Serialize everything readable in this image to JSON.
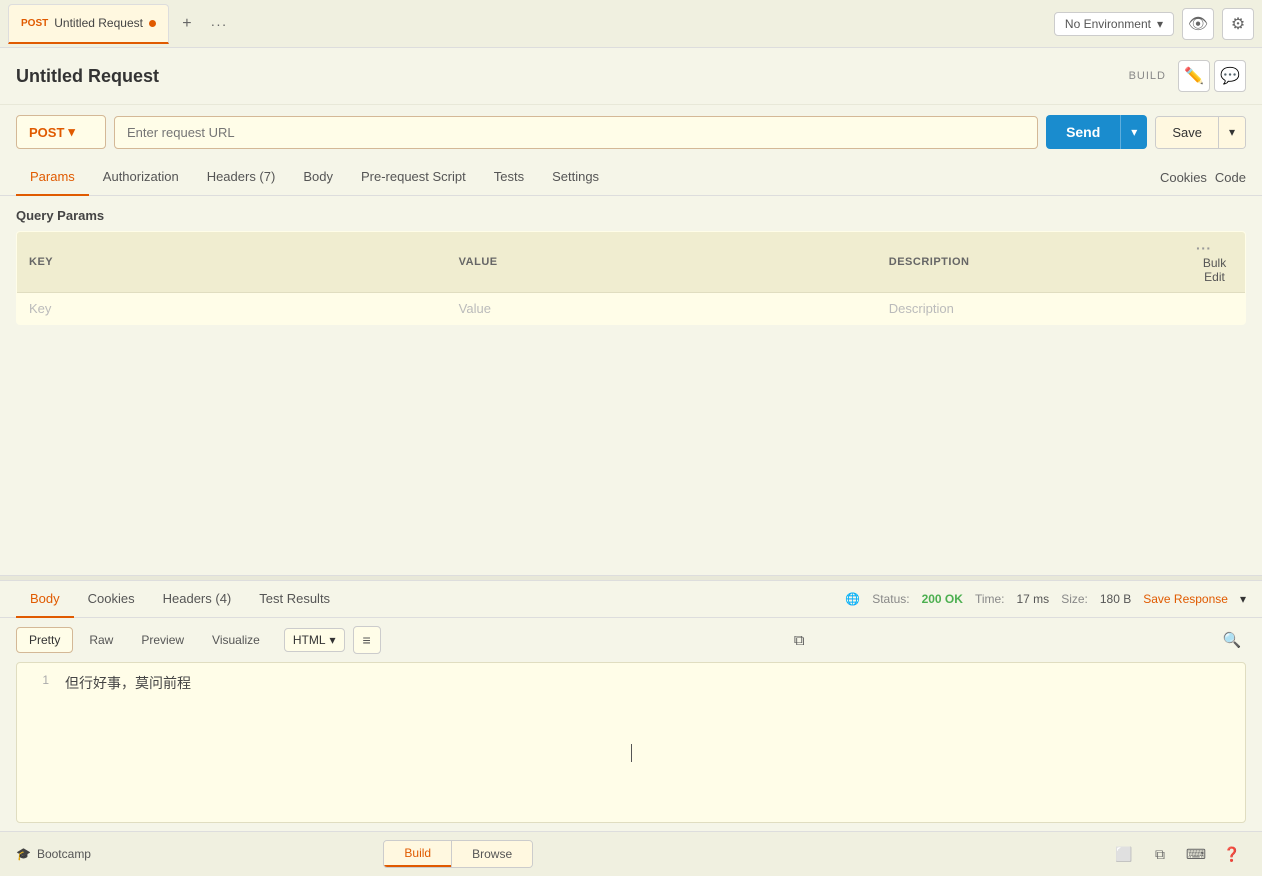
{
  "tab": {
    "method": "POST",
    "title": "Untitled Request",
    "dot": true
  },
  "toolbar": {
    "add_label": "+",
    "more_label": "···",
    "env_placeholder": "No Environment",
    "env_options": [
      "No Environment"
    ]
  },
  "page": {
    "title": "Untitled Request",
    "build_label": "BUILD"
  },
  "url_bar": {
    "method": "POST",
    "placeholder": "Enter request URL",
    "send_label": "Send",
    "save_label": "Save"
  },
  "request_tabs": {
    "tabs": [
      "Params",
      "Authorization",
      "Headers (7)",
      "Body",
      "Pre-request Script",
      "Tests",
      "Settings"
    ],
    "active": "Params",
    "cookies_label": "Cookies",
    "code_label": "Code"
  },
  "query_params": {
    "title": "Query Params",
    "columns": {
      "key": "KEY",
      "value": "VALUE",
      "description": "DESCRIPTION"
    },
    "placeholder": {
      "key": "Key",
      "value": "Value",
      "description": "Description"
    },
    "bulk_edit_label": "Bulk Edit"
  },
  "response_tabs": {
    "tabs": [
      "Body",
      "Cookies",
      "Headers (4)",
      "Test Results"
    ],
    "active": "Body",
    "status_label": "Status:",
    "status_value": "200 OK",
    "time_label": "Time:",
    "time_value": "17 ms",
    "size_label": "Size:",
    "size_value": "180 B",
    "save_response_label": "Save Response"
  },
  "response_format": {
    "tabs": [
      "Pretty",
      "Raw",
      "Preview",
      "Visualize"
    ],
    "active": "Pretty",
    "type": "HTML",
    "wrap_icon": "≡"
  },
  "response_content": {
    "line_number": "1",
    "text": "但行好事，莫问前程"
  },
  "bottom_bar": {
    "bootcamp_label": "Bootcamp",
    "build_label": "Build",
    "browse_label": "Browse",
    "active": "Build"
  }
}
